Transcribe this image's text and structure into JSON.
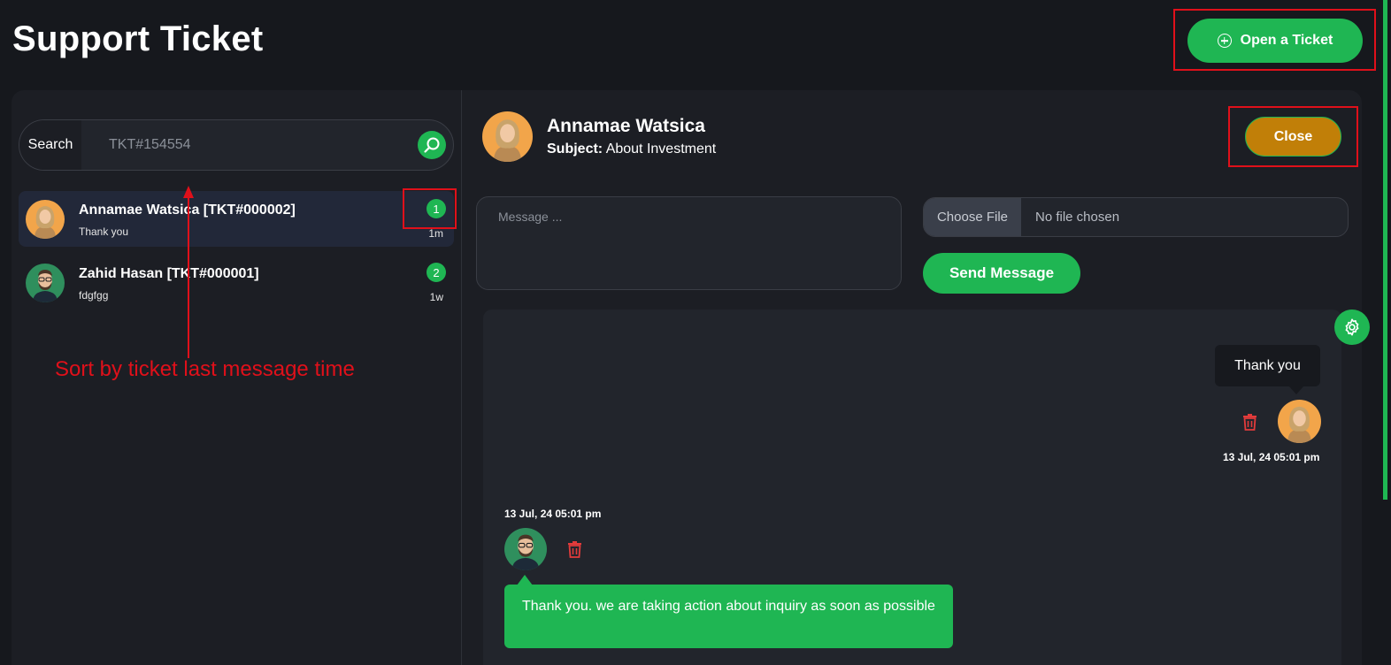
{
  "page": {
    "title": "Support Ticket"
  },
  "header": {
    "open_ticket_label": "Open a Ticket"
  },
  "search": {
    "label": "Search",
    "placeholder": "TKT#154554"
  },
  "tickets": [
    {
      "name": "Annamae Watsica [TKT#000002]",
      "preview": "Thank you",
      "badge": "1",
      "time": "1m",
      "avatar": "female-avatar",
      "active": true
    },
    {
      "name": "Zahid Hasan [TKT#000001]",
      "preview": "fdgfgg",
      "badge": "2",
      "time": "1w",
      "avatar": "male-avatar",
      "active": false
    }
  ],
  "annotation": {
    "text": "Sort by ticket last message time"
  },
  "chat": {
    "name": "Annamae Watsica",
    "subject_label": "Subject:",
    "subject": "About Investment",
    "close_label": "Close",
    "message_placeholder": "Message ...",
    "choose_file_label": "Choose File",
    "file_status": "No file chosen",
    "send_label": "Send Message",
    "messages": [
      {
        "text": "Thank you",
        "time": "13 Jul, 24 05:01 pm",
        "side": "right"
      },
      {
        "text": "Thank you. we are taking action about inquiry as soon as possible",
        "time": "13 Jul, 24 05:01 pm",
        "side": "left"
      }
    ]
  },
  "colors": {
    "accent": "#1fb653",
    "close": "#c17f08",
    "annotation": "#e0101a",
    "delete": "#e23b3b"
  }
}
